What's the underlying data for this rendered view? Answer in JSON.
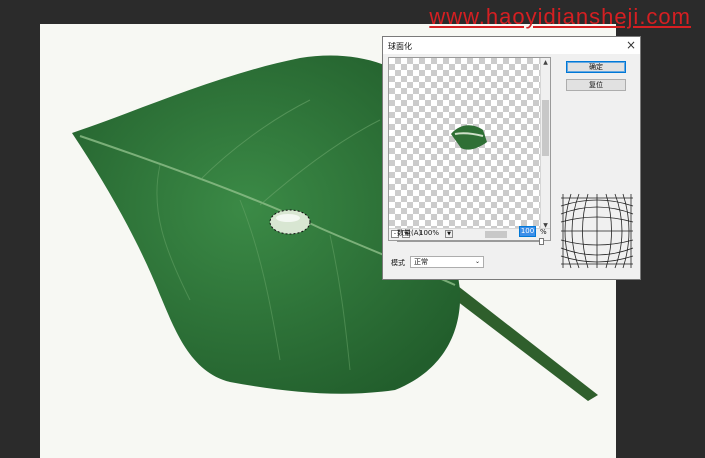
{
  "watermark": {
    "text": "www.haoyidiansheji.com"
  },
  "dialog": {
    "title": "球面化",
    "close_icon": "close-icon",
    "ok_label": "确定",
    "reset_label": "复位",
    "preview": {
      "zoom": "100%",
      "zoom_out": "-",
      "zoom_in": "+"
    },
    "amount": {
      "label": "数量(A)",
      "value": "100",
      "unit": "%"
    },
    "mode": {
      "label": "模式",
      "value": "正常"
    }
  },
  "colors": {
    "canvas_bg": "#f7f8f3",
    "workspace_bg": "#2b2b2b",
    "leaf": "#2e7d3c",
    "watermark": "#d51f22",
    "accent": "#0078d7"
  }
}
